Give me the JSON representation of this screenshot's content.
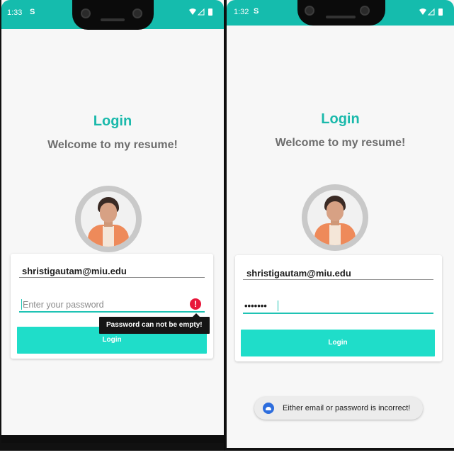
{
  "left": {
    "status": {
      "time": "1:33",
      "sim": "S"
    },
    "title": "Login",
    "subtitle": "Welcome to my resume!",
    "email_value": "shristigautam@miu.edu",
    "password_placeholder": "Enter your password",
    "error_tooltip": "Password can not be empty!",
    "login_label": "Login"
  },
  "right": {
    "status": {
      "time": "1:32",
      "sim": "S"
    },
    "title": "Login",
    "subtitle": "Welcome to my resume!",
    "email_value": "shristigautam@miu.edu",
    "password_value": "•••••••",
    "login_label": "Login",
    "toast_message": "Either email or password is incorrect!"
  },
  "icons": {
    "status_right": "wifi-icon signal-icon battery-icon",
    "error": "error-icon",
    "toast_app": "app-icon"
  },
  "colors": {
    "accent": "#15bcad",
    "button": "#1fddc9",
    "error": "#e8173b"
  }
}
